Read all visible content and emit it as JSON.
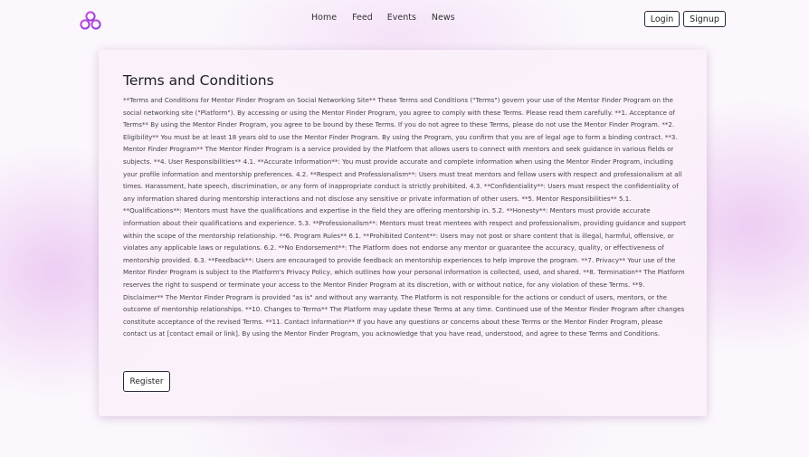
{
  "nav": {
    "links": [
      "Home",
      "Feed",
      "Events",
      "News"
    ],
    "login_label": "Login",
    "signup_label": "Signup",
    "logo_icon": "triple-circle-logo-icon",
    "accent_color": "#b046d6"
  },
  "terms": {
    "title": "Terms and Conditions",
    "body": "**Terms and Conditions for Mentor Finder Program on Social Networking Site** These Terms and Conditions (\"Terms\") govern your use of the Mentor Finder Program on the social networking site (\"Platform\"). By accessing or using the Mentor Finder Program, you agree to comply with these Terms. Please read them carefully. **1. Acceptance of Terms** By using the Mentor Finder Program, you agree to be bound by these Terms. If you do not agree to these Terms, please do not use the Mentor Finder Program. **2. Eligibility** You must be at least 18 years old to use the Mentor Finder Program. By using the Program, you confirm that you are of legal age to form a binding contract. **3. Mentor Finder Program** The Mentor Finder Program is a service provided by the Platform that allows users to connect with mentors and seek guidance in various fields or subjects. **4. User Responsibilities** 4.1. **Accurate Information**: You must provide accurate and complete information when using the Mentor Finder Program, including your profile information and mentorship preferences. 4.2. **Respect and Professionalism**: Users must treat mentors and fellow users with respect and professionalism at all times. Harassment, hate speech, discrimination, or any form of inappropriate conduct is strictly prohibited. 4.3. **Confidentiality**: Users must respect the confidentiality of any information shared during mentorship interactions and not disclose any sensitive or private information of other users. **5. Mentor Responsibilities** 5.1. **Qualifications**: Mentors must have the qualifications and expertise in the field they are offering mentorship in. 5.2. **Honesty**: Mentors must provide accurate information about their qualifications and experience. 5.3. **Professionalism**: Mentors must treat mentees with respect and professionalism, providing guidance and support within the scope of the mentorship relationship. **6. Program Rules** 6.1. **Prohibited Content**: Users may not post or share content that is illegal, harmful, offensive, or violates any applicable laws or regulations. 6.2. **No Endorsement**: The Platform does not endorse any mentor or guarantee the accuracy, quality, or effectiveness of mentorship provided. 6.3. **Feedback**: Users are encouraged to provide feedback on mentorship experiences to help improve the program. **7. Privacy** Your use of the Mentor Finder Program is subject to the Platform's Privacy Policy, which outlines how your personal information is collected, used, and shared. **8. Termination** The Platform reserves the right to suspend or terminate your access to the Mentor Finder Program at its discretion, with or without notice, for any violation of these Terms. **9. Disclaimer** The Mentor Finder Program is provided \"as is\" and without any warranty. The Platform is not responsible for the actions or conduct of users, mentors, or the outcome of mentorship relationships. **10. Changes to Terms** The Platform may update these Terms at any time. Continued use of the Mentor Finder Program after changes constitute acceptance of the revised Terms. **11. Contact Information** If you have any questions or concerns about these Terms or the Mentor Finder Program, please contact us at [contact email or link]. By using the Mentor Finder Program, you acknowledge that you have read, understood, and agree to these Terms and Conditions.",
    "register_label": "Register"
  }
}
